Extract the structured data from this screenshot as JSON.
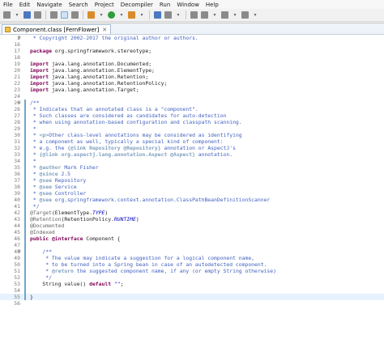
{
  "menu": [
    "File",
    "Edit",
    "Navigate",
    "Search",
    "Project",
    "Decompiler",
    "Run",
    "Window",
    "Help"
  ],
  "tab": {
    "label": "Component.class [FernFlower]",
    "close": "✕"
  },
  "icons": {
    "tab": "class-file-icon",
    "toolbar": [
      "new-icon",
      "save-icon",
      "print-icon",
      "debug-icon",
      "run-icon",
      "external-tools-icon",
      "search-icon",
      "navigate-icon",
      "back-icon",
      "forward-icon"
    ]
  },
  "lines": [
    {
      "n": "2",
      "t": " * Copyright 2002-2017 the original author or authors."
    },
    {
      "n": "16",
      "t": ""
    },
    {
      "n": "17",
      "t": "package org.springframework.stereotype;"
    },
    {
      "n": "18",
      "t": ""
    },
    {
      "n": "19",
      "t": "import java.lang.annotation.Documented;"
    },
    {
      "n": "20",
      "t": "import java.lang.annotation.ElementType;"
    },
    {
      "n": "21",
      "t": "import java.lang.annotation.Retention;"
    },
    {
      "n": "22",
      "t": "import java.lang.annotation.RetentionPolicy;"
    },
    {
      "n": "23",
      "t": "import java.lang.annotation.Target;"
    },
    {
      "n": "24",
      "t": ""
    },
    {
      "n": "26",
      "t": "/**"
    },
    {
      "n": "26",
      "t": " * Indicates that an annotated class is a \"component\"."
    },
    {
      "n": "27",
      "t": " * Such classes are considered as candidates for auto-detection"
    },
    {
      "n": "28",
      "t": " * when using annotation-based configuration and classpath scanning."
    },
    {
      "n": "29",
      "t": " *"
    },
    {
      "n": "30",
      "t": " * <p>Other class-level annotations may be considered as identifying"
    },
    {
      "n": "31",
      "t": " * a component as well, typically a special kind of component:"
    },
    {
      "n": "32",
      "t": " * e.g. the {@link Repository @Repository} annotation or AspectJ's"
    },
    {
      "n": "33",
      "t": " * {@link org.aspectj.lang.annotation.Aspect @Aspect} annotation."
    },
    {
      "n": "34",
      "t": " *"
    },
    {
      "n": "35",
      "t": " * @author Mark Fisher"
    },
    {
      "n": "36",
      "t": " * @since 2.5"
    },
    {
      "n": "37",
      "t": " * @see Repository"
    },
    {
      "n": "38",
      "t": " * @see Service"
    },
    {
      "n": "39",
      "t": " * @see Controller"
    },
    {
      "n": "40",
      "t": " * @see org.springframework.context.annotation.ClassPathBeanDefinitionScanner"
    },
    {
      "n": "41",
      "t": " */"
    },
    {
      "n": "42",
      "t": "@Target(ElementType.TYPE)"
    },
    {
      "n": "43",
      "t": "@Retention(RetentionPolicy.RUNTIME)"
    },
    {
      "n": "44",
      "t": "@Documented"
    },
    {
      "n": "45",
      "t": "@Indexed"
    },
    {
      "n": "46",
      "t": "public @interface Component {"
    },
    {
      "n": "47",
      "t": ""
    },
    {
      "n": "48",
      "t": "    /**"
    },
    {
      "n": "49",
      "t": "     * The value may indicate a suggestion for a logical component name,"
    },
    {
      "n": "50",
      "t": "     * to be turned into a Spring bean in case of an autodetected component."
    },
    {
      "n": "51",
      "t": "     * @return the suggested component name, if any (or empty String otherwise)"
    },
    {
      "n": "52",
      "t": "     */"
    },
    {
      "n": "53",
      "t": "    String value() default \"\";"
    },
    {
      "n": "54",
      "t": ""
    },
    {
      "n": "55",
      "t": "}"
    },
    {
      "n": "56",
      "t": ""
    }
  ]
}
